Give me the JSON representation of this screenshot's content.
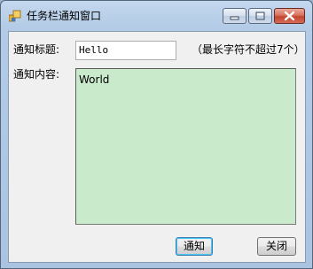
{
  "window": {
    "title": "任务栏通知窗口",
    "colors": {
      "content_background": "#c9ebcb",
      "frame": "#b3cbe6",
      "close_button": "#c2452f"
    }
  },
  "title_bar": {
    "icons": [
      "app-icon",
      "minimize-icon",
      "maximize-icon",
      "close-icon"
    ]
  },
  "form": {
    "title_label": "通知标题:",
    "title_value": "Hello",
    "title_hint": "（最长字符不超过7个）",
    "content_label": "通知内容:",
    "content_value": "World"
  },
  "buttons": {
    "notify": "通知",
    "close": "关闭"
  }
}
